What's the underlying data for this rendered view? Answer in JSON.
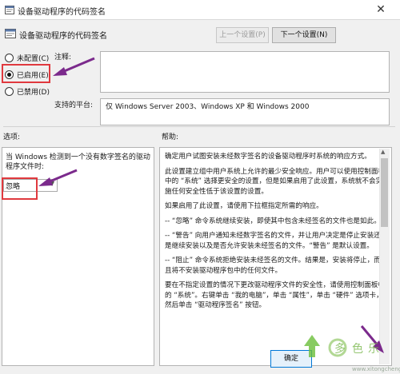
{
  "window": {
    "title": "设备驱动程序的代码签名",
    "close_glyph": "✕"
  },
  "header": {
    "title": "设备驱动程序的代码签名",
    "prev_button": "上一个设置(P)",
    "next_button": "下一个设置(N)"
  },
  "state": {
    "options": [
      {
        "label": "未配置(C)",
        "selected": false
      },
      {
        "label": "已启用(E)",
        "selected": true
      },
      {
        "label": "已禁用(D)",
        "selected": false
      }
    ]
  },
  "comment": {
    "label": "注释:",
    "value": ""
  },
  "platform": {
    "label": "支持的平台:",
    "value": "仅 Windows Server 2003、Windows XP 和 Windows 2000"
  },
  "options_section": {
    "label": "选项:",
    "description": "当 Windows 检测到一个没有数字签名的驱动程序文件时:",
    "select_value": "忽略"
  },
  "help_section": {
    "label": "帮助:",
    "paragraphs": [
      "确定用户试图安装未经数字签名的设备驱动程序时系统的响应方式。",
      "此设置建立组中用户系统上允许的最少安全响应。用户可以使用控制面板中的 “系统” 选择更安全的设置，但是如果启用了此设置，系统就不会实施任何安全性低于该设置的设置。",
      "如果启用了此设置，请使用下拉框指定所需的响应。",
      "-- “忽略” 命令系统继续安装，即使其中包含未经签名的文件也是如此。",
      "-- “警告” 向用户通知未经数字签名的文件，并让用户决定是停止安装还是继续安装以及是否允许安装未经签名的文件。“警告” 是默认设置。",
      "-- “阻止” 命令系统拒绝安装未经签名的文件。结果是，安装将停止，而且将不安装驱动程序包中的任何文件。",
      "要在不指定设置的情况下更改驱动程序文件的安全性，请使用控制面板中的 “系统”。右键单击 “我的电脑”，单击 “属性”，单击 “硬件” 选项卡，然后单击 “驱动程序签名” 按钮。"
    ]
  },
  "buttons": {
    "ok": "确定"
  },
  "watermark": {
    "url": "www.xitongcheng.com"
  },
  "colors": {
    "highlight": "#e0393e",
    "arrow": "#7b2a8c"
  }
}
